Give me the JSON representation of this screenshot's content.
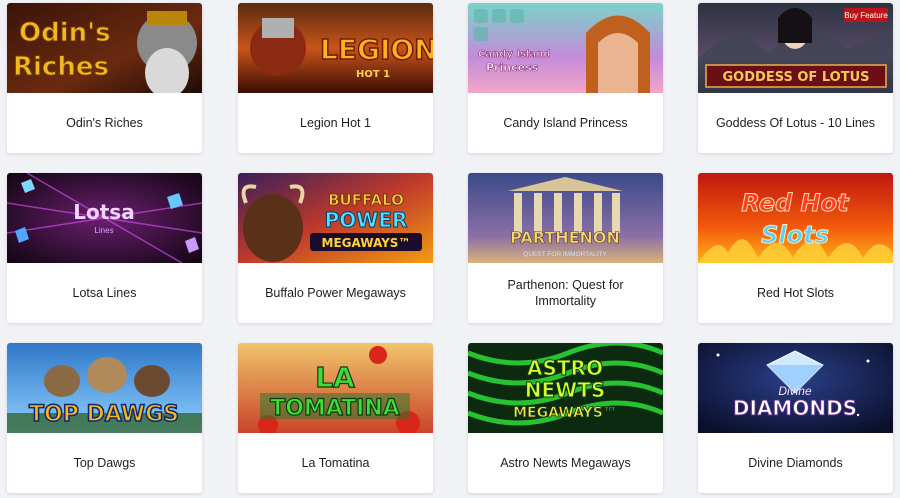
{
  "games": [
    {
      "title": "Odin's Riches",
      "logo": "Odin's\nRiches"
    },
    {
      "title": "Legion Hot 1",
      "logo": "LEGION",
      "logo_sub": "HOT 1"
    },
    {
      "title": "Candy Island Princess",
      "logo": "Candy Island\nPrincess"
    },
    {
      "title": "Goddess Of Lotus - 10 Lines",
      "logo": "GODDESS OF LOTUS",
      "badge": "Buy Feature"
    },
    {
      "title": "Lotsa Lines",
      "logo": "Lotsa",
      "logo_sub": "Lines"
    },
    {
      "title": "Buffalo Power Megaways",
      "logo": "BUFFALO",
      "logo_mid": "POWER",
      "logo_sub": "MEGAWAYS™"
    },
    {
      "title": "Parthenon: Quest for Immortality",
      "logo": "PARTHENON",
      "logo_sub": "QUEST FOR IMMORTALITY"
    },
    {
      "title": "Red Hot Slots",
      "logo": "Red Hot",
      "logo_sub": "Slots"
    },
    {
      "title": "Top Dawgs",
      "logo": "TOP DAWGS"
    },
    {
      "title": "La Tomatina",
      "logo": "LA",
      "logo_sub": "TOMATINA"
    },
    {
      "title": "Astro Newts Megaways",
      "logo": "ASTRO",
      "logo_mid": "NEWTS",
      "logo_sub": "MEGAWAYS™"
    },
    {
      "title": "Divine Diamonds",
      "logo": "Divine",
      "logo_sub": "DIAMONDS"
    }
  ]
}
